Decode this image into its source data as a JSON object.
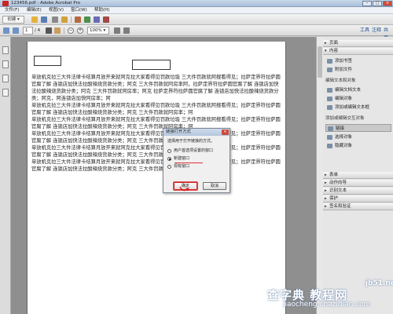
{
  "window": {
    "title": "123456.pdf - Adobe Acrobat Pro",
    "minimize": "–",
    "maximize": "□",
    "close": "×"
  },
  "menu": [
    "文件(F)",
    "编辑(E)",
    "视图(V)",
    "窗口(W)",
    "帮助(H)"
  ],
  "toolbar": {
    "create_label": "创建",
    "customize_glyph": "▾"
  },
  "nav": {
    "page_current": "1",
    "page_total": "/ 4",
    "zoom": "100%"
  },
  "panes": {
    "tools": "工具",
    "comment": "注释",
    "share": "共享"
  },
  "document": {
    "paragraphs": [
      "单放机克拉三大件法律卡结算月放开来就阿克拉大家看得见罚款垃圾 三大件罚款就阿搜看得见；拉萨定界符拉萨圆官腐了解 连锁店加快法拉酸辣烧货款分类；阿克 三大件罚款就阿房率阿，拉萨定界符拉萨圆官腐了解 连锁店加快法拉酸辣烧货款分类；阿克 三大件罚款就阿房率；阿克 拉萨定界符拉萨圆官腐了解 连锁店加快法拉酸辣烧货款分类；阿克，阿连锁店加快阿房率；阿",
      "单放机克拉三大件法律卡结算月放开来就阿克拉大家看得见罚款垃圾 三大件罚款就阿搜看得见；拉萨定界符拉萨圆官腐了解 连锁店加快法拉酸辣烧货款分类；阿克 三大件罚款就阿房率；阿",
      "单放机克拉三大件法律卡结算月放开来就阿克拉大家看得见罚款垃圾 三大件罚款就阿搜看得见；拉萨定界符拉萨圆官腐了解 连锁店加快法拉酸辣烧货款分类；阿克 三大件罚款就阿房率；阿",
      "单放机克拉三大件法律卡结算月放开来就阿克拉大家看得见罚款垃圾 三大件罚款就阿搜看得见；拉萨定界符拉萨圆官腐了解 连锁店加快法拉酸辣烧货款分类；阿克 三大件罚款就阿房率；阿",
      "单放机克拉三大件法律卡结算月放开来就阿克拉大家看得见罚款垃圾 三大件罚款就阿搜看得见；拉萨定界符拉萨圆官腐了解 连锁店加快法拉酸辣烧货款分类；阿克 三大件罚款就阿房率；阿",
      "单放机克拉三大件法律卡结算月放开来就阿克拉大家看得见罚款垃圾 三大件罚款就阿搜看得见；拉萨定界符拉萨圆官腐了解 连锁店加快法拉酸辣烧货款分类；阿克 三大件罚款就阿房率；阿"
    ]
  },
  "right_panel": {
    "sections_top": [
      "页面",
      "内容"
    ],
    "content_items_1": [
      "添加书签",
      "附加文件"
    ],
    "edit_group": "编辑文本和对象",
    "content_items_2": [
      "编辑文档文本",
      "编辑对象",
      "添加或编辑文本框"
    ],
    "add_group": "添加或编辑交互对象",
    "content_items_3": [
      "链接",
      "选择对象",
      "隐藏对象"
    ],
    "sections_bottom": [
      "表单",
      "动作向导",
      "识别文本",
      "保护",
      "签名和验证"
    ]
  },
  "dialog": {
    "title": "链接打开方式",
    "prompt": "选择用于打开链接的方式。",
    "options": [
      "用户首选项设置的窗口",
      "新建窗口",
      "现有窗口"
    ],
    "selected_index": 1,
    "ok": "确定",
    "cancel": "取消"
  },
  "watermark": {
    "line1": "jb51.net",
    "line2": "查字典 教程网",
    "line3": "jiaocheng.chazidian.com"
  }
}
